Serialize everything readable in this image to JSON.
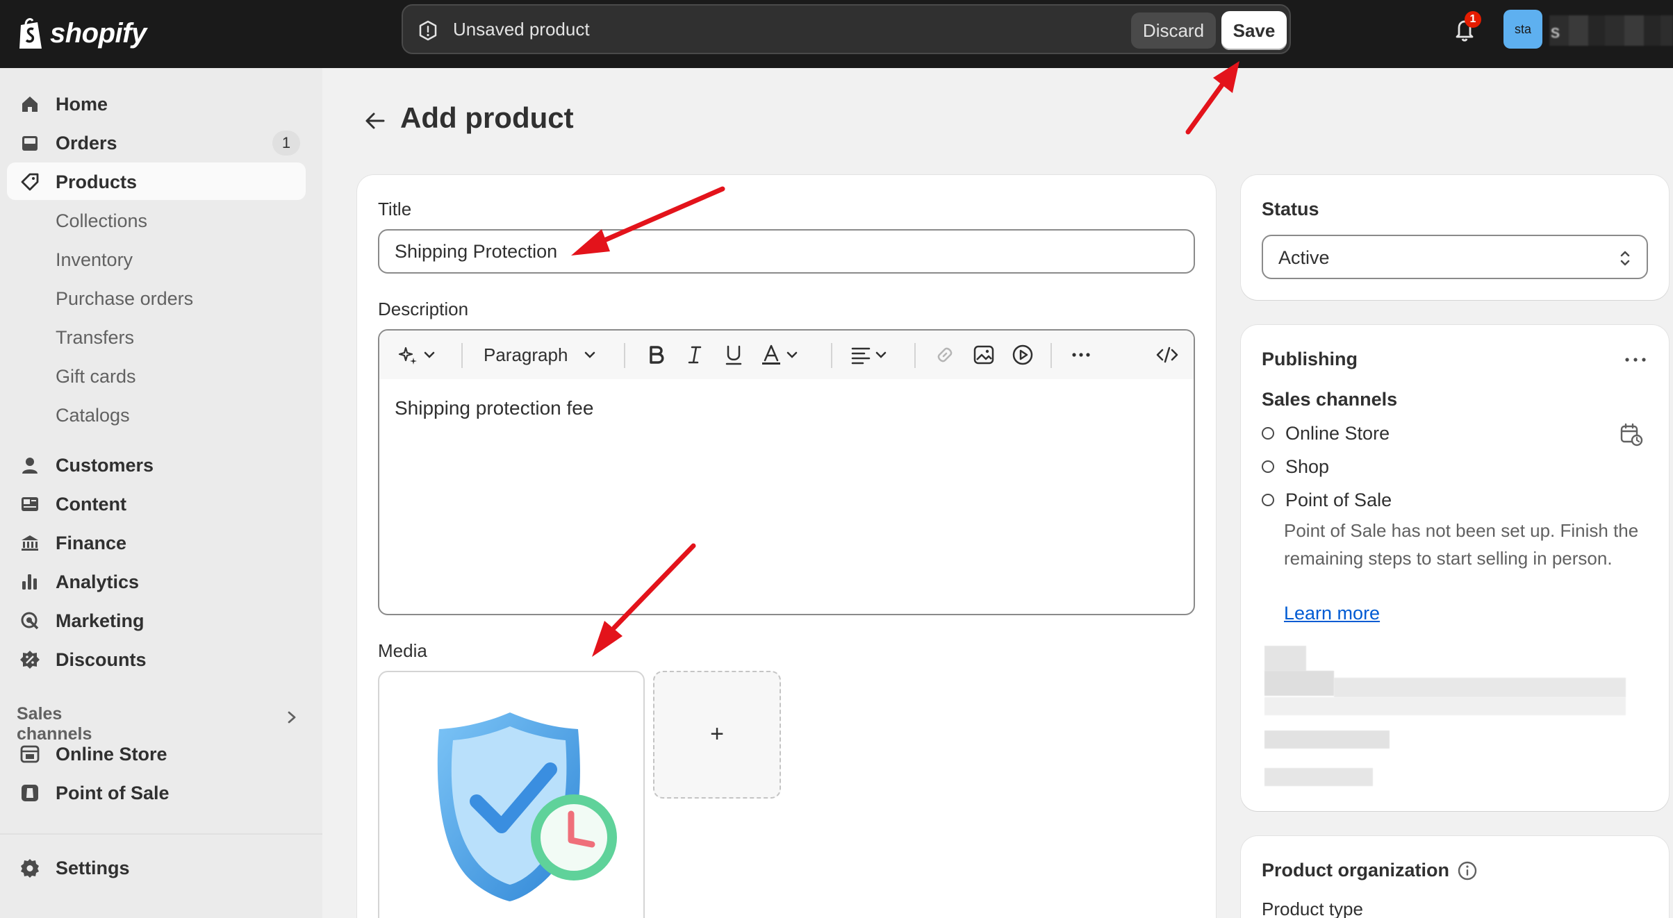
{
  "app": {
    "brand": "shopify",
    "accent_color": "#1a1a1a"
  },
  "contextual_bar": {
    "message": "Unsaved product",
    "discard_label": "Discard",
    "save_label": "Save"
  },
  "topbar": {
    "notification_count": "1",
    "avatar_initials": "sta",
    "store_name_first_letter": "s"
  },
  "sidebar": {
    "items": [
      {
        "label": "Home",
        "icon": "home-icon"
      },
      {
        "label": "Orders",
        "icon": "orders-icon",
        "badge": "1"
      },
      {
        "label": "Products",
        "icon": "tag-icon",
        "active": true
      },
      {
        "label": "Collections",
        "sub": true
      },
      {
        "label": "Inventory",
        "sub": true
      },
      {
        "label": "Purchase orders",
        "sub": true
      },
      {
        "label": "Transfers",
        "sub": true
      },
      {
        "label": "Gift cards",
        "sub": true
      },
      {
        "label": "Catalogs",
        "sub": true
      },
      {
        "label": "Customers",
        "icon": "person-icon"
      },
      {
        "label": "Content",
        "icon": "content-icon"
      },
      {
        "label": "Finance",
        "icon": "bank-icon"
      },
      {
        "label": "Analytics",
        "icon": "bar-chart-icon"
      },
      {
        "label": "Marketing",
        "icon": "target-icon"
      },
      {
        "label": "Discounts",
        "icon": "discount-icon"
      }
    ],
    "sales_channels_header": "Sales channels",
    "channels": [
      {
        "label": "Online Store",
        "icon": "store-icon"
      },
      {
        "label": "Point of Sale",
        "icon": "pos-icon"
      }
    ],
    "settings_label": "Settings"
  },
  "page": {
    "title": "Add product"
  },
  "product_form": {
    "title_label": "Title",
    "title_value": "Shipping Protection",
    "description_label": "Description",
    "toolbar": {
      "paragraph_label": "Paragraph"
    },
    "description_value": "Shipping protection fee",
    "media_label": "Media",
    "add_media_symbol": "+"
  },
  "status_card": {
    "title": "Status",
    "value": "Active"
  },
  "publishing_card": {
    "title": "Publishing",
    "sales_channels_label": "Sales channels",
    "channels": [
      "Online Store",
      "Shop",
      "Point of Sale"
    ],
    "pos_note": "Point of Sale has not been set up. Finish the remaining steps to start selling in person.",
    "learn_more": "Learn more"
  },
  "organization_card": {
    "title": "Product organization",
    "product_type_label": "Product type"
  }
}
